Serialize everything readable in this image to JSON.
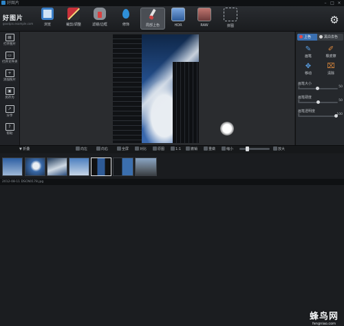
{
  "window": {
    "title": "好图片"
  },
  "logo": {
    "name": "好图片",
    "sub": "goodpix.example.com"
  },
  "toolbar": {
    "tools": [
      {
        "label": "浏览",
        "icon": "browse-icon",
        "color": "#3b7fc8"
      },
      {
        "label": "裁剪/调整",
        "icon": "crop-ruler-icon",
        "color": "#c9313a"
      },
      {
        "label": "滤镜/边框",
        "icon": "filter-jar-icon",
        "color": "#8a8f96"
      },
      {
        "label": "修饰",
        "icon": "water-drop-icon",
        "color": "#2f8fd8"
      },
      {
        "label": "局部上色",
        "icon": "brush-icon",
        "color": "#d9d9d9"
      },
      {
        "label": "HDR",
        "icon": "hdr-icon",
        "color": "#4f77b5"
      },
      {
        "label": "RAW",
        "icon": "raw-icon",
        "color": "#6a737c"
      },
      {
        "label": "拼图",
        "icon": "collage-icon",
        "color": "#6a737c"
      }
    ],
    "active_index": 4
  },
  "left_panel": {
    "items": [
      {
        "label": "打开图片",
        "icon": "open-file-icon"
      },
      {
        "label": "打开文件夹",
        "icon": "folder-icon"
      },
      {
        "label": "添加照片",
        "icon": "add-photo-icon"
      },
      {
        "label": "另存为",
        "icon": "save-as-icon"
      },
      {
        "label": "分享",
        "icon": "share-icon"
      },
      {
        "label": "帮助",
        "icon": "help-icon"
      }
    ]
  },
  "right_panel": {
    "tab_color": "上色",
    "tab_erase": "黑白去色",
    "tools": [
      {
        "label": "画笔",
        "icon": "pen-icon"
      },
      {
        "label": "橡皮擦",
        "icon": "eraser-icon"
      },
      {
        "label": "移动",
        "icon": "move-icon"
      },
      {
        "label": "清除",
        "icon": "clear-broom-icon"
      }
    ],
    "sliders": [
      {
        "label": "画笔大小",
        "value": 50,
        "min": 1,
        "max": 100
      },
      {
        "label": "画笔硬度",
        "value": 50,
        "min": 0,
        "max": 100
      },
      {
        "label": "画笔透明度",
        "value": 100,
        "min": 0,
        "max": 100
      }
    ]
  },
  "bottom_bar": {
    "collapse": "▼ 折叠",
    "rotate_left": "向左",
    "rotate_right": "向右",
    "fit": "全屏",
    "compare": "对比",
    "original": "原图",
    "ratio": "1:1",
    "undo": "撤销",
    "redo": "重做",
    "zoom_out": "缩小",
    "zoom_in": "放大",
    "zoom_level": 0.22
  },
  "filmstrip": {
    "thumbs": [
      {
        "selected": false
      },
      {
        "selected": false
      },
      {
        "selected": false
      },
      {
        "selected": false
      },
      {
        "selected": true
      },
      {
        "selected": false
      },
      {
        "selected": false
      }
    ]
  },
  "status": {
    "text": "2012-08-11 DSCN0178.jpg"
  },
  "watermark": {
    "main": "蜂鸟网",
    "url": "fengniao.com"
  }
}
